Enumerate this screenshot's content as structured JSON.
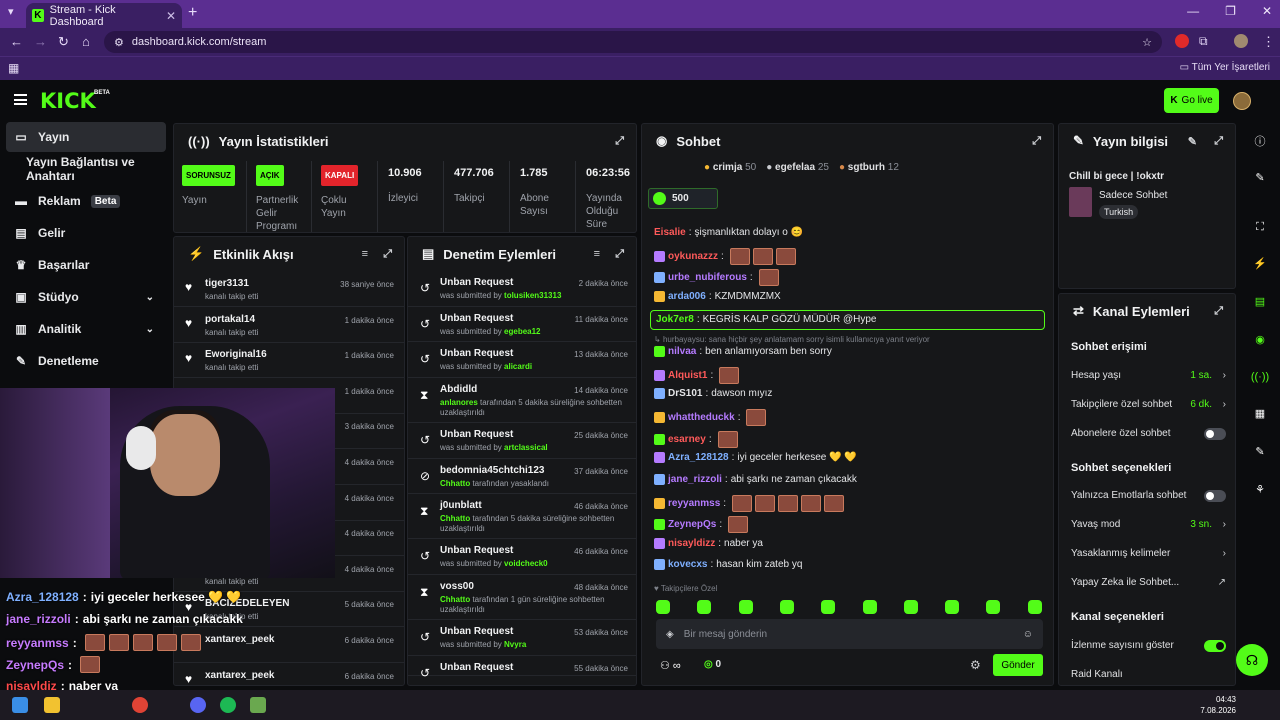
{
  "browser": {
    "tab_title": "Stream - Kick Dashboard",
    "url": "dashboard.kick.com/stream",
    "bookmarks_label": "Tüm Yer İşaretleri"
  },
  "header": {
    "logo": "KICK",
    "beta": "BETA",
    "go_live": "Go live"
  },
  "sidebar": {
    "items": [
      {
        "label": "Yayın"
      },
      {
        "label": "Yayın Bağlantısı ve Anahtarı"
      },
      {
        "label": "Reklam",
        "badge": "Beta"
      },
      {
        "label": "Gelir"
      },
      {
        "label": "Başarılar"
      },
      {
        "label": "Stüdyo"
      },
      {
        "label": "Analitik"
      },
      {
        "label": "Denetleme"
      }
    ]
  },
  "stats": {
    "title": "Yayın İstatistikleri",
    "items": [
      {
        "badge": "SORUNSUZ",
        "label": "Yayın",
        "badge_color": "#53fc18"
      },
      {
        "badge": "AÇIK",
        "label": "Partnerlik Gelir Programı",
        "badge_color": "#53fc18"
      },
      {
        "badge": "KAPALI",
        "label": "Çoklu Yayın",
        "badge_color": "#e3242b"
      },
      {
        "value": "10.906",
        "label": "İzleyici"
      },
      {
        "value": "477.706",
        "label": "Takipçi"
      },
      {
        "value": "1.785",
        "label": "Abone Sayısı"
      },
      {
        "value": "06:23:56",
        "label": "Yayında Olduğu Süre"
      }
    ]
  },
  "activity": {
    "title": "Etkinlik Akışı",
    "items": [
      {
        "name": "tiger3131",
        "sub": "kanalı takip etti",
        "time": "38 saniye önce"
      },
      {
        "name": "portakal14",
        "sub": "kanalı takip etti",
        "time": "1 dakika önce"
      },
      {
        "name": "Eworiginal16",
        "sub": "kanalı takip etti",
        "time": "1 dakika önce"
      },
      {
        "name": "",
        "sub": "",
        "time": "1 dakika önce"
      },
      {
        "name": "",
        "sub": "",
        "time": "3 dakika önce"
      },
      {
        "name": "",
        "sub": "",
        "time": "4 dakika önce"
      },
      {
        "name": "",
        "sub": "",
        "time": "4 dakika önce"
      },
      {
        "name": "",
        "sub": "",
        "time": "4 dakika önce"
      },
      {
        "name": "",
        "sub": "kanalı takip etti",
        "time": "4 dakika önce"
      },
      {
        "name": "BACIZEDELEYEN",
        "sub": "kanalı takip etti",
        "time": "5 dakika önce"
      },
      {
        "name": "xantarex_peek",
        "sub": "",
        "time": "6 dakika önce"
      },
      {
        "name": "xantarex_peek",
        "sub": "",
        "time": "6 dakika önce"
      }
    ]
  },
  "moderation": {
    "title": "Denetim Eylemleri",
    "items": [
      {
        "title": "Unban Request",
        "pre": "was submitted by ",
        "user": "tolusiken31313",
        "post": "",
        "time": "2 dakika önce"
      },
      {
        "title": "Unban Request",
        "pre": "was submitted by ",
        "user": "egebea12",
        "post": "",
        "time": "11 dakika önce"
      },
      {
        "title": "Unban Request",
        "pre": "was submitted by ",
        "user": "alicardi",
        "post": "",
        "time": "13 dakika önce"
      },
      {
        "title": "Abdidld",
        "pre": "",
        "user": "anlanores",
        "post": " tarafından 5 dakika süreliğine sohbetten uzaklaştırıldı",
        "time": "14 dakika önce"
      },
      {
        "title": "Unban Request",
        "pre": "was submitted by ",
        "user": "artclassical",
        "post": "",
        "time": "25 dakika önce"
      },
      {
        "title": "bedomnia45chtchi123",
        "pre": "",
        "user": "Chhatto",
        "post": " tarafından yasaklandı",
        "time": "37 dakika önce"
      },
      {
        "title": "j0unblatt",
        "pre": "",
        "user": "Chhatto",
        "post": " tarafından 5 dakika süreliğine sohbetten uzaklaştırıldı",
        "time": "46 dakika önce"
      },
      {
        "title": "Unban Request",
        "pre": "was submitted by ",
        "user": "voidcheck0",
        "post": "",
        "time": "46 dakika önce"
      },
      {
        "title": "voss00",
        "pre": "",
        "user": "Chhatto",
        "post": " tarafından 1 gün süreliğine sohbetten uzaklaştırıldı",
        "time": "48 dakika önce"
      },
      {
        "title": "Unban Request",
        "pre": "was submitted by ",
        "user": "Nvyra",
        "post": "",
        "time": "53 dakika önce"
      },
      {
        "title": "Unban Request",
        "pre": "",
        "user": "",
        "post": "",
        "time": "55 dakika önce"
      }
    ]
  },
  "chat": {
    "title": "Sohbet",
    "top_users": [
      {
        "name": "crimja",
        "count": "50"
      },
      {
        "name": "egefelaa",
        "count": "25"
      },
      {
        "name": "sgtburh",
        "count": "12"
      }
    ],
    "goal": "500",
    "messages": [
      {
        "user": "Eisalie",
        "color": "#ff5a5a",
        "text": "şişmanlıktan dolayı o 😊",
        "emotes": 0
      },
      {
        "user": "oykunazzz",
        "color": "#ff5a5a",
        "text": "",
        "emotes": 3
      },
      {
        "user": "urbe_nubiferous",
        "color": "#b57bff",
        "text": "",
        "emotes": 1
      },
      {
        "user": "arda006",
        "color": "#7fb0ff",
        "text": "KZMDMMZMX",
        "emotes": 0
      },
      {
        "user": "nilvaa",
        "color": "#b57bff",
        "text": "ben anlamıyorsam ben sorry",
        "emotes": 0
      },
      {
        "user": "Alquist1",
        "color": "#ff5a5a",
        "text": "",
        "emotes": 1
      },
      {
        "user": "DrS101",
        "color": "#e5e6e8",
        "text": "dawson mıyız",
        "emotes": 0
      },
      {
        "user": "whattheduckk",
        "color": "#b57bff",
        "text": "",
        "emotes": 1
      },
      {
        "user": "esarney",
        "color": "#ff5a5a",
        "text": "",
        "emotes": 1
      },
      {
        "user": "Azra_128128",
        "color": "#7fb0ff",
        "text": "iyi geceler herkesee 💛 💛",
        "emotes": 0
      },
      {
        "user": "jane_rizzoli",
        "color": "#b57bff",
        "text": "abi şarkı ne zaman çıkacakk",
        "emotes": 0
      },
      {
        "user": "reyyanmss",
        "color": "#b57bff",
        "text": "",
        "emotes": 5
      },
      {
        "user": "ZeynepQs",
        "color": "#b57bff",
        "text": "",
        "emotes": 1
      },
      {
        "user": "nisayldizz",
        "color": "#ff5a5a",
        "text": "naber ya",
        "emotes": 0
      },
      {
        "user": "kovecxs",
        "color": "#7fb0ff",
        "text": "hasan kim zateb yq",
        "emotes": 0
      }
    ],
    "highlight": {
      "user": "Jok7er8",
      "text": "KEGRİS KALP GÖZÜ MÜDÜR @Hype"
    },
    "reply_note": "hurbayaysu: sana hiçbir şey anlatamam sorry isimli kullanıcıya yanıt veriyor",
    "followers_only": "Takipçilere Özel",
    "placeholder": "Bir mesaj gönderin",
    "count": "0",
    "send": "Gönder"
  },
  "info": {
    "title": "Yayın bilgisi",
    "stream_title": "Chill bi gece | !okxtr",
    "category": "Sadece Sohbet",
    "tag": "Turkish"
  },
  "actions": {
    "title": "Kanal Eylemleri",
    "chat_access": "Sohbet erişimi",
    "account_age": {
      "label": "Hesap yaşı",
      "value": "1 sa."
    },
    "followers_only": {
      "label": "Takipçilere özel sohbet",
      "value": "6 dk."
    },
    "subs_only": {
      "label": "Abonelere özel sohbet"
    },
    "chat_options": "Sohbet seçenekleri",
    "emote_only": {
      "label": "Yalnızca Emotlarla sohbet"
    },
    "slow_mode": {
      "label": "Yavaş mod",
      "value": "3 sn."
    },
    "banned_words": {
      "label": "Yasaklanmış kelimeler"
    },
    "ai_chat": {
      "label": "Yapay Zeka ile Sohbet..."
    },
    "channel_options": "Kanal seçenekleri",
    "show_views": {
      "label": "İzlenme sayısını göster"
    },
    "raid": {
      "label": "Raid Kanalı"
    }
  },
  "overlay": [
    {
      "user": "Azra_128128",
      "text": "iyi geceler herkesee 💛 💛",
      "color": "#7fb0ff"
    },
    {
      "user": "jane_rizzoli",
      "text": "abi şarkı ne zaman çıkacakk",
      "color": "#c77bff"
    },
    {
      "user": "reyyanmss",
      "text": "",
      "color": "#c77bff"
    },
    {
      "user": "ZeynepQs",
      "text": "",
      "color": "#c77bff"
    },
    {
      "user": "nisayldiz",
      "text": "naber ya",
      "color": "#ff4a4a"
    },
    {
      "user": "kovecxs",
      "text": "hasan kim zateb yq",
      "color": "#7fb0ff"
    }
  ],
  "taskbar": {
    "time": "04:43",
    "date": "7.08.2026"
  }
}
